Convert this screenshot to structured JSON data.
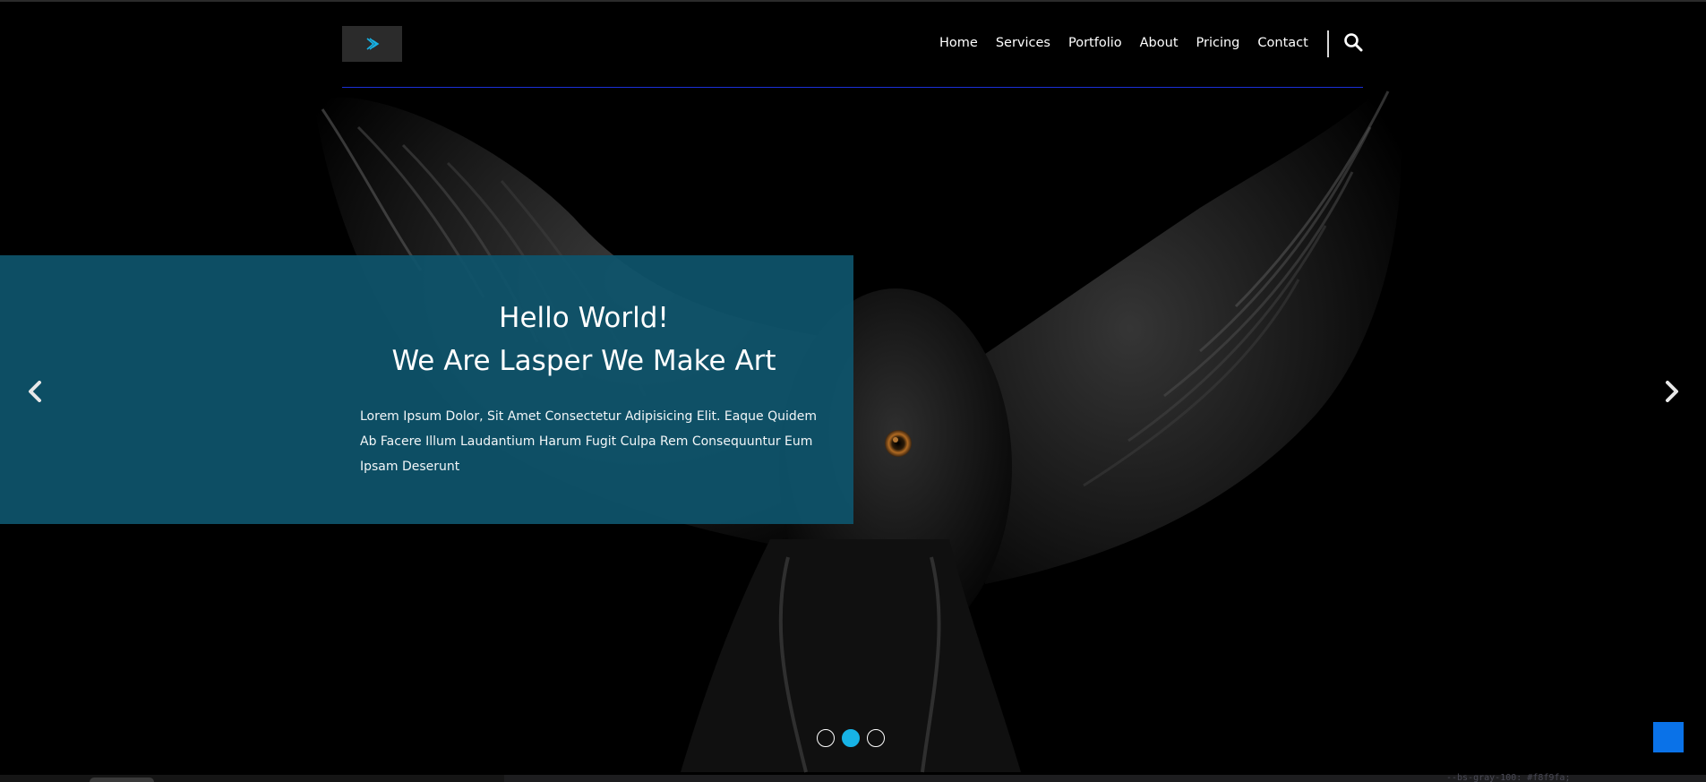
{
  "header": {
    "logo_icon": "play-arrows-icon",
    "nav": [
      "Home",
      "Services",
      "Portfolio",
      "About",
      "Pricing",
      "Contact"
    ],
    "search_icon": "search-icon"
  },
  "slide": {
    "title_line_1": "Hello World!",
    "title_line_2": "We Are Lasper We Make Art",
    "text": "Lorem Ipsum Dolor, Sit Amet Consectetur Adipisicing Elit. Eaque Quidem Ab Facere Illum Laudantium Harum Fugit Culpa Rem Consequuntur Eum Ipsam Deserunt"
  },
  "carousel": {
    "prev_icon": "chevron-left-icon",
    "next_icon": "chevron-right-icon",
    "slide_count": 3,
    "active_index": 1
  },
  "bottom_strip": {
    "code_snippet": "--bs-gray-100: #f8f9fa;"
  },
  "colors": {
    "caption_bg": "#0e546c",
    "accent": "#17b3e6",
    "header_rule": "#1a2fd6",
    "scroll_top": "#0a72e8"
  }
}
